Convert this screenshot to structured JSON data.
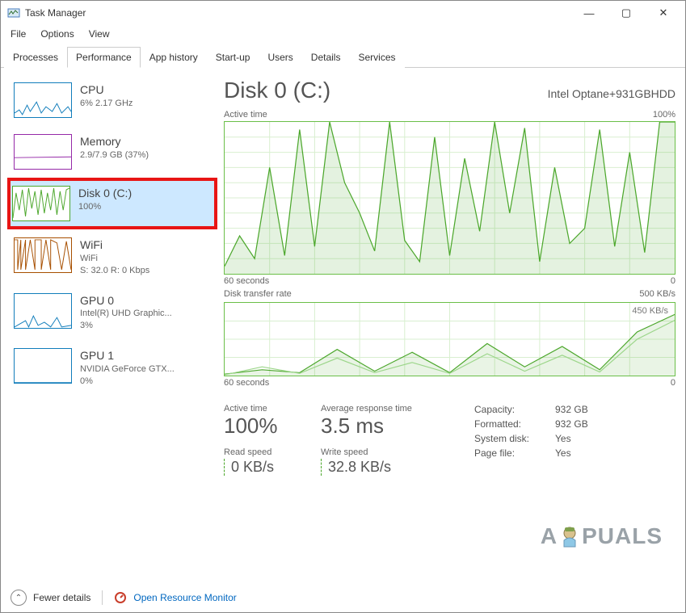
{
  "window": {
    "title": "Task Manager",
    "controls": {
      "min": "—",
      "max": "▢",
      "close": "✕"
    }
  },
  "menu": {
    "file": "File",
    "options": "Options",
    "view": "View"
  },
  "tabs": {
    "processes": "Processes",
    "performance": "Performance",
    "apphistory": "App history",
    "startup": "Start-up",
    "users": "Users",
    "details": "Details",
    "services": "Services"
  },
  "sidebar": {
    "cpu": {
      "title": "CPU",
      "sub": "6%  2.17 GHz"
    },
    "memory": {
      "title": "Memory",
      "sub": "2.9/7.9 GB (37%)"
    },
    "disk0": {
      "title": "Disk 0 (C:)",
      "sub": "100%"
    },
    "wifi": {
      "title": "WiFi",
      "sub1": "WiFi",
      "sub2": "S: 32.0  R: 0 Kbps"
    },
    "gpu0": {
      "title": "GPU 0",
      "sub1": "Intel(R) UHD Graphic...",
      "sub2": "3%"
    },
    "gpu1": {
      "title": "GPU 1",
      "sub1": "NVIDIA GeForce GTX...",
      "sub2": "0%"
    }
  },
  "main": {
    "title": "Disk 0 (C:)",
    "device": "Intel Optane+931GBHDD",
    "activeLabel": "Active time",
    "activeMax": "100%",
    "xferLabel": "Disk transfer rate",
    "xferMax": "500 KB/s",
    "xferMarker": "450 KB/s",
    "timeLeft": "60 seconds",
    "timeRight": "0",
    "stats": {
      "activeTimeLabel": "Active time",
      "activeTime": "100%",
      "avgRespLabel": "Average response time",
      "avgResp": "3.5 ms",
      "readLabel": "Read speed",
      "read": "0 KB/s",
      "writeLabel": "Write speed",
      "write": "32.8 KB/s"
    },
    "info": {
      "capacityLabel": "Capacity:",
      "capacity": "932 GB",
      "formattedLabel": "Formatted:",
      "formatted": "932 GB",
      "sysdiskLabel": "System disk:",
      "sysdisk": "Yes",
      "pagefileLabel": "Page file:",
      "pagefile": "Yes"
    }
  },
  "statusbar": {
    "fewer": "Fewer details",
    "openrm": "Open Resource Monitor"
  },
  "watermark": "A  PUALS",
  "chart_data": [
    {
      "type": "line",
      "title": "Active time",
      "ylabel": "%",
      "ylim": [
        0,
        100
      ],
      "xlim_seconds": [
        60,
        0
      ],
      "x": [
        60,
        58,
        56,
        54,
        52,
        50,
        48,
        46,
        44,
        42,
        40,
        38,
        36,
        34,
        32,
        30,
        28,
        26,
        24,
        22,
        20,
        18,
        16,
        14,
        12,
        10,
        8,
        6,
        4,
        2,
        0
      ],
      "values": [
        5,
        25,
        10,
        70,
        12,
        95,
        18,
        100,
        60,
        40,
        15,
        100,
        22,
        8,
        90,
        12,
        76,
        28,
        100,
        40,
        96,
        8,
        70,
        20,
        30,
        95,
        18,
        80,
        14,
        100,
        100
      ]
    },
    {
      "type": "line",
      "title": "Disk transfer rate",
      "ylabel": "KB/s",
      "ylim": [
        0,
        500
      ],
      "xlim_seconds": [
        60,
        0
      ],
      "series": [
        {
          "name": "Read",
          "x": [
            60,
            55,
            50,
            45,
            40,
            35,
            30,
            25,
            20,
            15,
            10,
            5,
            0
          ],
          "values": [
            10,
            40,
            20,
            180,
            30,
            160,
            20,
            220,
            60,
            200,
            40,
            300,
            420
          ]
        },
        {
          "name": "Write",
          "x": [
            60,
            55,
            50,
            45,
            40,
            35,
            30,
            25,
            20,
            15,
            10,
            5,
            0
          ],
          "values": [
            5,
            60,
            15,
            120,
            20,
            90,
            15,
            150,
            30,
            140,
            25,
            250,
            380
          ]
        }
      ]
    }
  ]
}
